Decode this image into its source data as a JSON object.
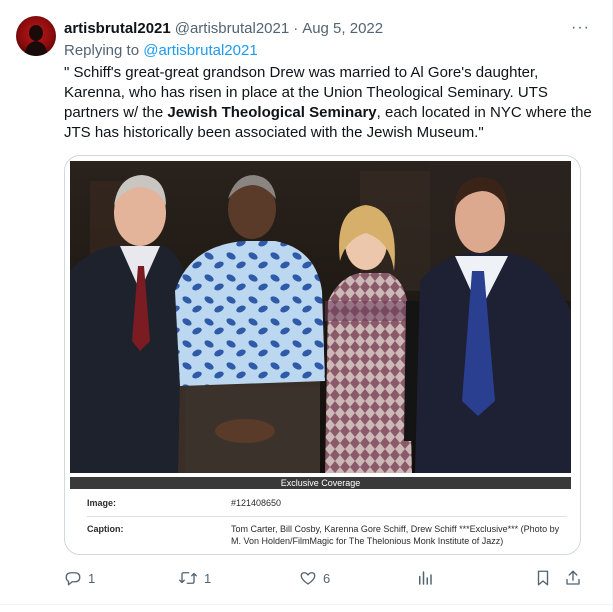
{
  "tweet": {
    "display_name": "artisbrutal2021",
    "handle": "@artisbrutal2021",
    "separator": "·",
    "date": "Aug 5, 2022",
    "more": "···",
    "replying_prefix": "Replying to",
    "replying_to": "@artisbrutal2021",
    "text_part1": "\" Schiff's great-great grandson Drew was married to Al Gore's daughter, Karenna, who has risen in place at the Union Theological Seminary. UTS partners w/ the ",
    "text_bold": "Jewish Theological Seminary",
    "text_part2": ", each located in NYC where the JTS has historically been associated with the Jewish Museum.\""
  },
  "media": {
    "coverage_label": "Exclusive Coverage",
    "image_label": "Image:",
    "image_value": "#121408650",
    "caption_label": "Caption:",
    "caption_value": "Tom Carter, Bill Cosby, Karenna Gore Schiff, Drew Schiff ***Exclusive*** (Photo by M. Von Holden/FilmMagic for The Thelonious Monk Institute of Jazz)"
  },
  "actions": {
    "replies": "1",
    "retweets": "1",
    "likes": "6"
  },
  "colors": {
    "accent": "#1d9bf0",
    "secondary_text": "#536471",
    "primary_text": "#0f1419"
  },
  "icons": [
    "more-icon",
    "reply-icon",
    "retweet-icon",
    "like-icon",
    "analytics-icon",
    "bookmark-icon",
    "share-icon"
  ]
}
